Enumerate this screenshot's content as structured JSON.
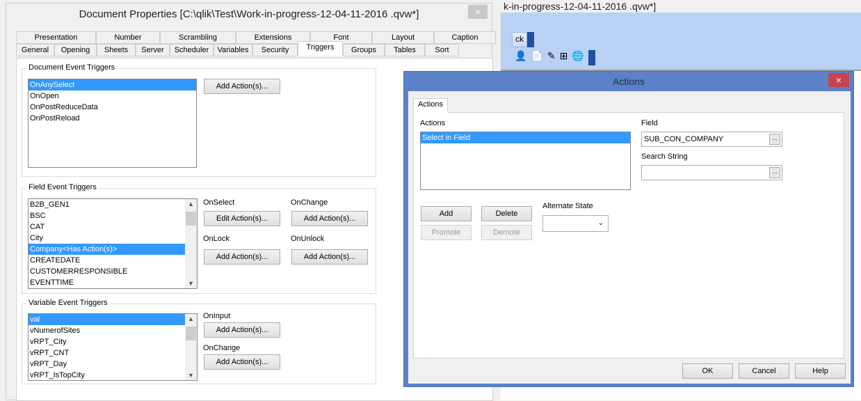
{
  "background": {
    "title_fragment": "k-in-progress-12-04-11-2016 .qvw*]",
    "toolbar_fragment": "ck"
  },
  "doc_dialog": {
    "title": "Document Properties [C:\\qlik\\Test\\Work-in-progress-12-04-11-2016 .qvw*]",
    "close": "×",
    "tabs_row1": [
      "Presentation",
      "Number",
      "Scrambling",
      "Extensions",
      "Font",
      "Layout",
      "Caption"
    ],
    "tabs_row2": [
      "General",
      "Opening",
      "Sheets",
      "Server",
      "Scheduler",
      "Variables",
      "Security",
      "Triggers",
      "Groups",
      "Tables",
      "Sort"
    ],
    "active_tab": "Triggers",
    "document_event": {
      "label": "Document Event Triggers",
      "items": [
        "OnAnySelect",
        "OnOpen",
        "OnPostReduceData",
        "OnPostReload"
      ],
      "selected": 0,
      "button": "Add Action(s)..."
    },
    "field_event": {
      "label": "Field Event Triggers",
      "items": [
        "B2B_GEN1",
        "BSC",
        "CAT",
        "City",
        "Company<Has Action(s)>",
        "CREATEDATE",
        "CUSTOMERRESPONSIBLE",
        "EVENTTIME"
      ],
      "selected": 4,
      "on_select": "OnSelect",
      "on_select_btn": "Edit Action(s)...",
      "on_change": "OnChange",
      "on_change_btn": "Add Action(s)...",
      "on_lock": "OnLock",
      "on_lock_btn": "Add Action(s)...",
      "on_unlock": "OnUnlock",
      "on_unlock_btn": "Add Action(s)..."
    },
    "variable_event": {
      "label": "Variable Event Triggers",
      "items": [
        "val",
        "vNumerofSites",
        "vRPT_City",
        "vRPT_CNT",
        "vRPT_Day",
        "vRPT_IsTopCity"
      ],
      "selected": 0,
      "on_input": "OnInput",
      "on_input_btn": "Add Action(s)...",
      "on_change": "OnChange",
      "on_change_btn": "Add Action(s)..."
    }
  },
  "actions_dialog": {
    "title": "Actions",
    "close": "×",
    "tab": "Actions",
    "actions_label": "Actions",
    "actions": [
      "Select in Field"
    ],
    "field_label": "Field",
    "field_value": "SUB_CON_COMPANY",
    "search_label": "Search String",
    "search_value": "",
    "ellipsis": "...",
    "add": "Add",
    "delete": "Delete",
    "promote": "Promote",
    "demote": "Demote",
    "alt_state_label": "Alternate State",
    "ok": "OK",
    "cancel": "Cancel",
    "help": "Help"
  }
}
